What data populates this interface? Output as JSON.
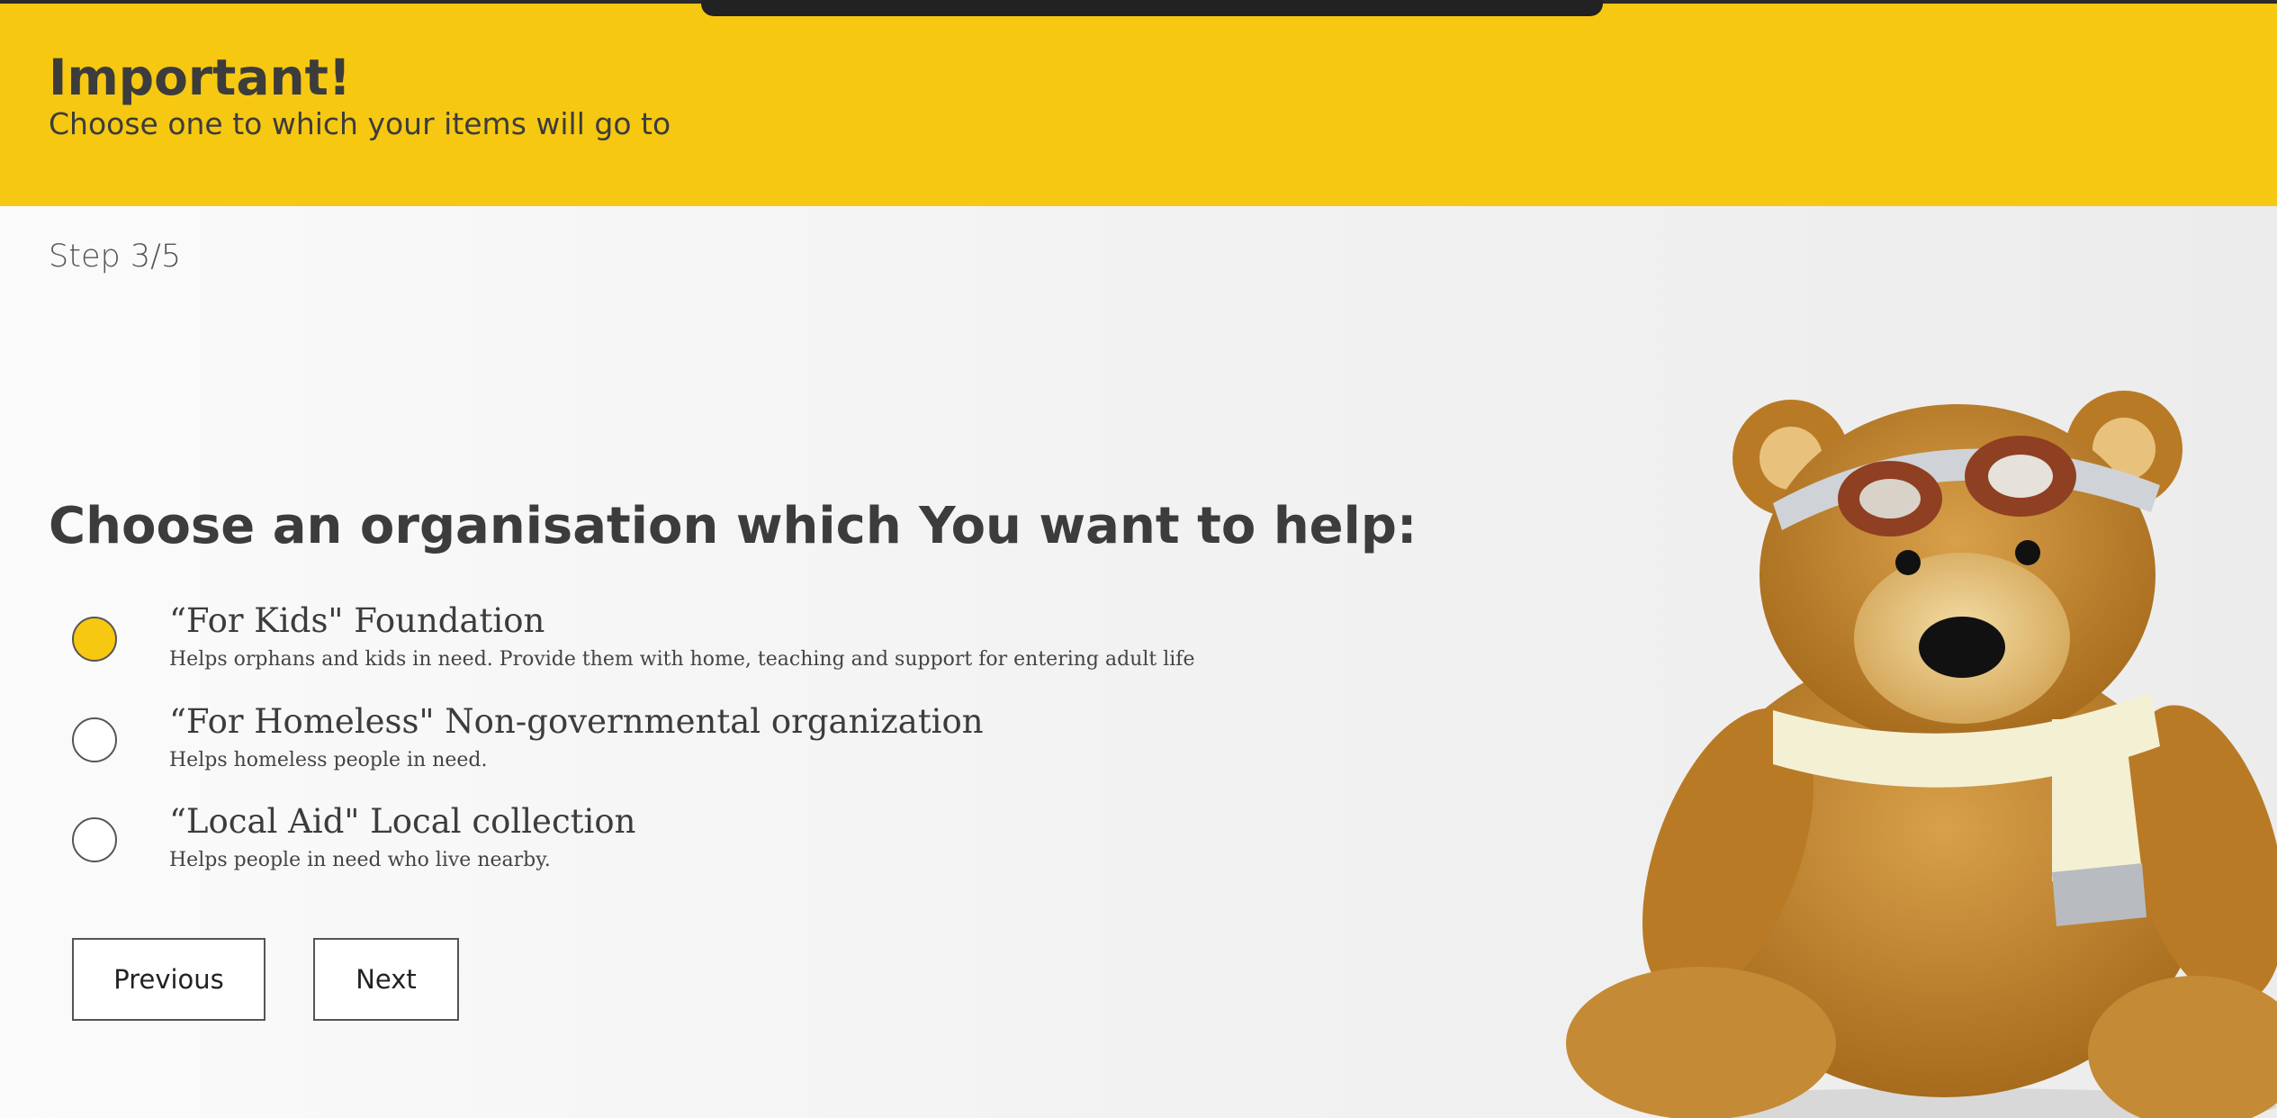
{
  "banner": {
    "title": "Important!",
    "subtitle": "Choose one to which your items will go to"
  },
  "step": "Step 3/5",
  "question": "Choose an organisation which You want to help:",
  "options": [
    {
      "title": "“For Kids\" Foundation",
      "description": "Helps orphans and kids in need. Provide them with home, teaching and support for entering adult life",
      "selected": true
    },
    {
      "title": "“For Homeless\" Non-governmental organization",
      "description": "Helps homeless people in need.",
      "selected": false
    },
    {
      "title": "“Local Aid\" Local collection",
      "description": "Helps people in need who live nearby.",
      "selected": false
    }
  ],
  "buttons": {
    "previous": "Previous",
    "next": "Next"
  },
  "colors": {
    "accent": "#f7c811",
    "text": "#3c3c3c"
  },
  "image": "teddy-bear-with-goggles-and-scarf"
}
